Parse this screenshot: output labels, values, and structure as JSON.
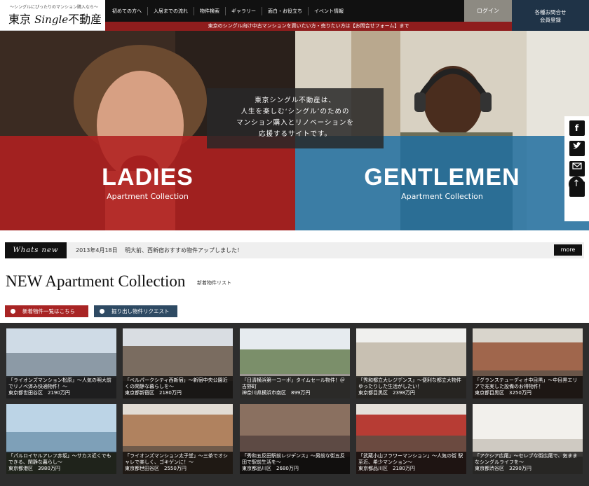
{
  "header": {
    "logo_tagline": "〜シングルにぴったりのマンション購入なら〜",
    "logo_name_a": "東京",
    "logo_name_b": "Single",
    "logo_name_c": "不動産",
    "nav": [
      "初めての方へ",
      "入居までの流れ",
      "物件検索",
      "ギャラリー",
      "面白・お役立ち",
      "イベント情報"
    ],
    "login_label": "ログイン",
    "contact_line1": "各種お問合せ",
    "contact_line2": "会員登録",
    "promo": "東京のシングル向け中古マンションを買いたい方・売りたい方は【お問合せフォーム】まで"
  },
  "hero": {
    "caption_line1": "東京シングル不動産は、",
    "caption_line2": "人生を楽しむ‘シングル’のための",
    "caption_line3": "マンション購入とリノベーションを",
    "caption_line4": "応援するサイトです。",
    "ladies_title": "LADIES",
    "ladies_sub": "Apartment Collection",
    "gentlemen_title": "GENTLEMEN",
    "gentlemen_sub": "Apartment Collection"
  },
  "social": [
    "facebook-icon",
    "twitter-icon",
    "mail-icon",
    "rss-icon"
  ],
  "news": {
    "label": "Whats new",
    "date": "2013年4月18日",
    "text": "明大前、西新宿おすすめ物件アップしました！",
    "more": "more"
  },
  "section": {
    "title": "NEW Apartment Collection",
    "subtitle": "新着物件リスト",
    "btn_list": "新着物件一覧はこちら",
    "btn_request": "掘り出し物件リクエスト"
  },
  "listings": [
    {
      "title": "「ライオンズマンション松原」〜人気の明大前でリノベ済み快適物件！〜",
      "area": "東京都世田谷区　2190万円",
      "color": "#9fb7c9"
    },
    {
      "title": "「ベルパークシティ西新宿」〜新宿中央公園近くの閑静な暮らしを〜",
      "area": "東京都新宿区　2180万円",
      "color": "#8a7f72"
    },
    {
      "title": "「日清横浜第一コーポ」タイムセール物件！＠吉野町",
      "area": "神奈川県横浜市南区　899万円",
      "color": "#8c9a7e"
    },
    {
      "title": "「秀和都立大レジデンス」〜便利な都立大物件　ゆったりした生活がしたい！",
      "area": "東京都目黒区　2398万円",
      "color": "#b8b2a6"
    },
    {
      "title": "「グランステューディオ中目黒」〜中目黒エリアで充実した設備のお得物件！",
      "area": "東京都目黒区　3250万円",
      "color": "#9b6f5a"
    },
    {
      "title": "「パルロイヤルアレフ赤坂」〜サカス近くでもできる、閑静な暮らし〜",
      "area": "東京都港区　3980万円",
      "color": "#8fa9bd"
    },
    {
      "title": "「ライオンズマンション太子堂」〜三茶でオシャレで楽しく、ゴキゲンに！〜",
      "area": "東京都世田谷区　2550万円",
      "color": "#a07a5f"
    },
    {
      "title": "「秀和五反田駅前レジデンス」〜男前な街五反田で駅前生活を〜",
      "area": "東京都品川区　2680万円",
      "color": "#6e5a52"
    },
    {
      "title": "「武蔵小山フラワーマンション」〜人気の街 駅至近、希少マンション〜",
      "area": "東京都品川区　2180万円",
      "color": "#9c3b34"
    },
    {
      "title": "「アクシア広尾」〜セレブな街広尾で、気ままなシングルライフを〜",
      "area": "東京都渋谷区　3290万円",
      "color": "#e8e4de"
    }
  ],
  "colors": {
    "accent_red": "#a82424",
    "accent_navy": "#1f3347",
    "promo_red": "#8f1d1d"
  }
}
